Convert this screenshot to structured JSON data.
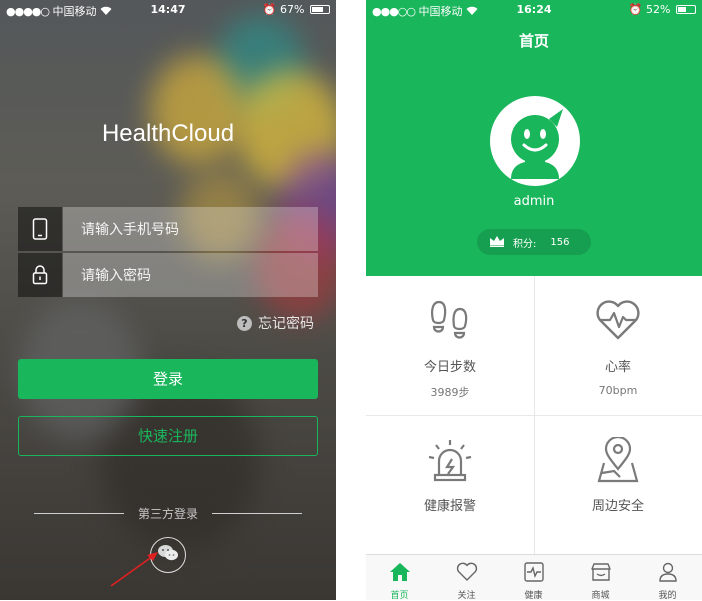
{
  "login": {
    "status_bar": {
      "signal": "●●●●○",
      "carrier": "中国移动",
      "time": "14:47",
      "battery": "67%",
      "battery_level": 0.67
    },
    "app_title": "HealthCloud",
    "phone_placeholder": "请输入手机号码",
    "password_placeholder": "请输入密码",
    "forgot_password": "忘记密码",
    "login_button": "登录",
    "register_button": "快速注册",
    "third_party_label": "第三方登录",
    "icons": [
      "phone-icon",
      "lock-icon",
      "question-icon",
      "wechat-icon"
    ],
    "colors": {
      "accent": "#1ab65c",
      "arrow": "#e02020"
    }
  },
  "home": {
    "status_bar": {
      "signal": "●●●○○",
      "carrier": "中国移动",
      "time": "16:24",
      "battery": "52%",
      "battery_level": 0.52
    },
    "page_title": "首页",
    "username": "admin",
    "points_label": "积分:",
    "points_value": "156",
    "cards": [
      {
        "title": "今日步数",
        "value": "3989步",
        "icon": "footsteps-icon"
      },
      {
        "title": "心率",
        "value": "70bpm",
        "icon": "heartbeat-icon"
      },
      {
        "title": "健康报警",
        "value": "",
        "icon": "alarm-icon"
      },
      {
        "title": "周边安全",
        "value": "",
        "icon": "map-pin-icon"
      }
    ],
    "tabs": [
      {
        "label": "首页",
        "icon": "home-icon",
        "active": true
      },
      {
        "label": "关注",
        "icon": "heart-icon",
        "active": false
      },
      {
        "label": "健康",
        "icon": "health-icon",
        "active": false
      },
      {
        "label": "商城",
        "icon": "store-icon",
        "active": false
      },
      {
        "label": "我的",
        "icon": "user-icon",
        "active": false
      }
    ],
    "colors": {
      "header": "#1ab65c",
      "icon": "#7a7a7a"
    }
  }
}
